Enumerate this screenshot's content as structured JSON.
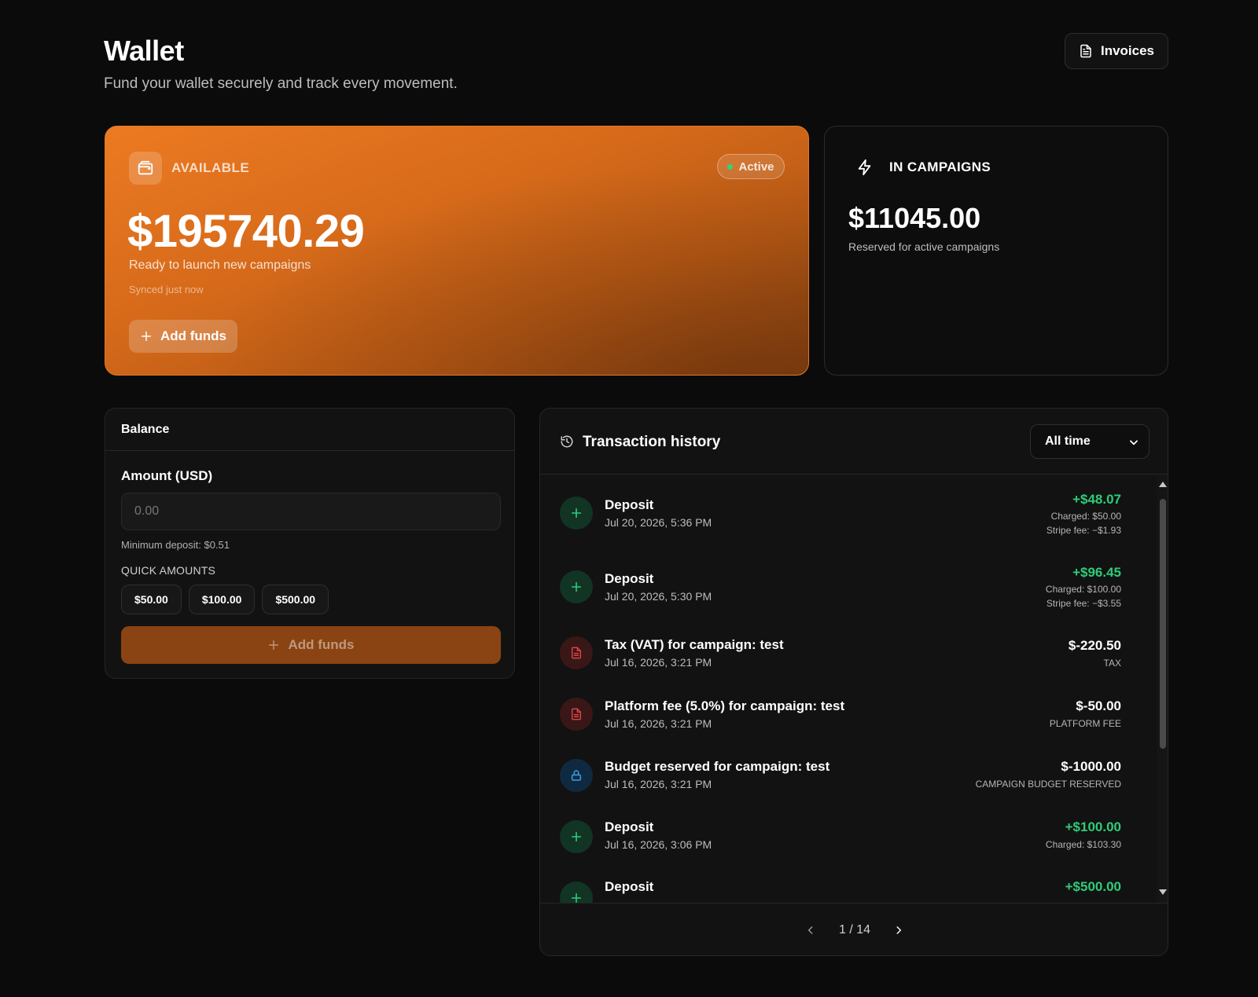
{
  "header": {
    "title": "Wallet",
    "subtitle": "Fund your wallet securely and track every movement.",
    "invoices_label": "Invoices"
  },
  "available": {
    "label": "AVAILABLE",
    "status": "Active",
    "amount": "$195740.29",
    "description": "Ready to launch new campaigns",
    "sync": "Synced just now",
    "add_funds": "Add funds"
  },
  "campaigns": {
    "label": "IN CAMPAIGNS",
    "amount": "$11045.00",
    "description": "Reserved for active campaigns"
  },
  "balance": {
    "title": "Balance",
    "amount_label": "Amount (USD)",
    "amount_placeholder": "0.00",
    "minimum": "Minimum deposit: $0.51",
    "quick_label": "QUICK AMOUNTS",
    "quick_amounts": [
      "$50.00",
      "$100.00",
      "$500.00"
    ],
    "add_funds": "Add funds"
  },
  "transactions": {
    "title": "Transaction history",
    "filter": "All time",
    "page": "1 / 14",
    "items": [
      {
        "name": "Deposit",
        "date": "Jul 20, 2026, 5:36 PM",
        "amount": "+$48.07",
        "meta1": "Charged: $50.00",
        "meta2": "Stripe fee: −$1.93",
        "kind": "deposit"
      },
      {
        "name": "Deposit",
        "date": "Jul 20, 2026, 5:30 PM",
        "amount": "+$96.45",
        "meta1": "Charged: $100.00",
        "meta2": "Stripe fee: −$3.55",
        "kind": "deposit"
      },
      {
        "name": "Tax (VAT) for campaign: test",
        "date": "Jul 16, 2026, 3:21 PM",
        "amount": "$-220.50",
        "meta1": "TAX",
        "kind": "fee"
      },
      {
        "name": "Platform fee (5.0%) for campaign: test",
        "date": "Jul 16, 2026, 3:21 PM",
        "amount": "$-50.00",
        "meta1": "PLATFORM FEE",
        "kind": "fee"
      },
      {
        "name": "Budget reserved for campaign: test",
        "date": "Jul 16, 2026, 3:21 PM",
        "amount": "$-1000.00",
        "meta1": "CAMPAIGN BUDGET RESERVED",
        "kind": "reserve"
      },
      {
        "name": "Deposit",
        "date": "Jul 16, 2026, 3:06 PM",
        "amount": "+$100.00",
        "meta1": "Charged: $103.30",
        "kind": "deposit"
      },
      {
        "name": "Deposit",
        "amount": "+$500.00",
        "kind": "deposit"
      }
    ]
  },
  "colors": {
    "accent": "#e8771f",
    "positive": "#2ecc78",
    "background": "#0b0b0b"
  },
  "icons": {
    "invoices": "document-icon",
    "available": "wallet-icon",
    "campaigns": "lightning-icon",
    "history": "history-icon",
    "deposit": "plus-icon",
    "fee": "receipt-icon",
    "reserve": "lock-icon"
  }
}
